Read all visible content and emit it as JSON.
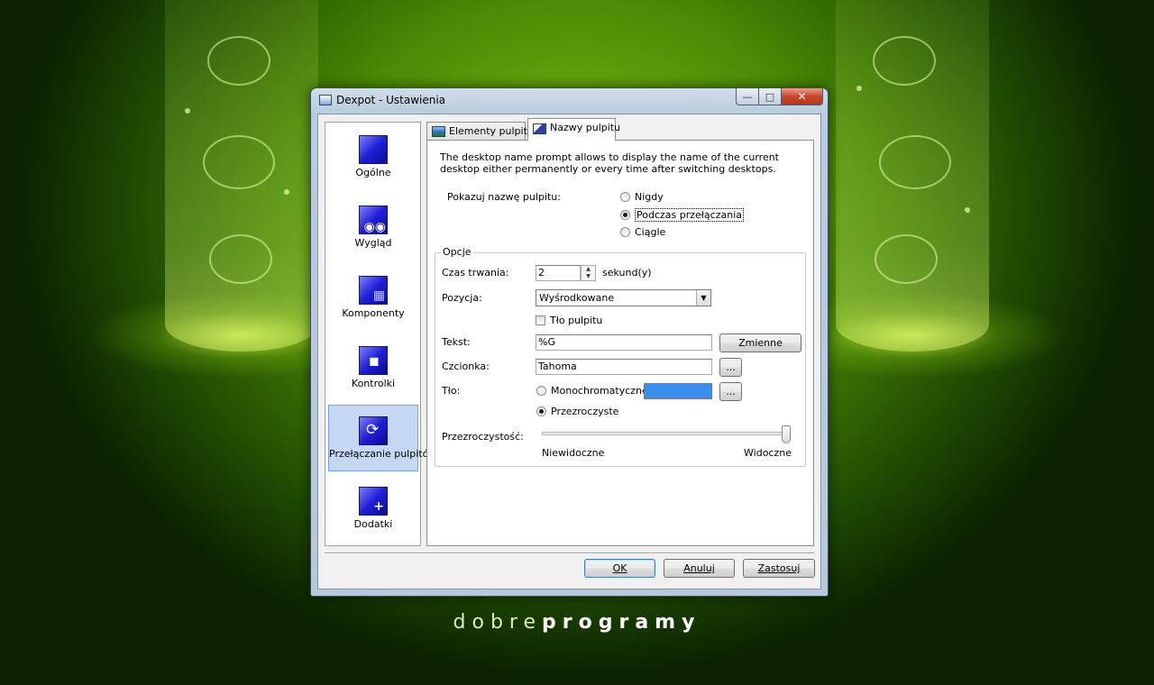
{
  "background": {
    "brand_regular": "dobre",
    "brand_bold": "programy",
    "accent_color": "#7fbe12"
  },
  "window": {
    "title": "Dexpot - Ustawienia",
    "icon": "dexpot-app-icon",
    "caption_buttons": {
      "minimize": "minimize-icon",
      "maximize": "maximize-icon",
      "close": "close-icon"
    }
  },
  "nav": {
    "items": [
      {
        "label": "Ogólne",
        "icon": "general-icon",
        "active": false
      },
      {
        "label": "Wygląd",
        "icon": "appearance-icon",
        "active": false
      },
      {
        "label": "Komponenty",
        "icon": "components-icon",
        "active": false
      },
      {
        "label": "Kontrolki",
        "icon": "controls-icon",
        "active": false
      },
      {
        "label": "Przełączanie pulpitów",
        "icon": "desktop-switching-icon",
        "active": true
      },
      {
        "label": "Dodatki",
        "icon": "addons-icon",
        "active": false
      }
    ],
    "active_color": "#c5d8f3"
  },
  "tabs": [
    {
      "label": "Elementy pulpitu",
      "icon": "desktop-elements-icon",
      "active": false
    },
    {
      "label": "Nazwy pulpitu",
      "icon": "desktop-names-icon",
      "active": true
    }
  ],
  "panel": {
    "description": "The desktop name prompt allows to display the name of the current desktop either permanently or every time after switching desktops.",
    "show_name_label": "Pokazuj nazwę pulpitu:",
    "show_options": [
      {
        "label": "Nigdy",
        "selected": false
      },
      {
        "label": "Podczas przełączania",
        "selected": true
      },
      {
        "label": "Ciągle",
        "selected": false
      }
    ],
    "options_group": {
      "title": "Opcje",
      "duration_label": "Czas trwania:",
      "duration_value": "2",
      "duration_unit": "sekund(y)",
      "position_label": "Pozycja:",
      "position_value": "Wyśrodkowane",
      "desktop_bg_checkbox": {
        "label": "Tło pulpitu",
        "checked": false
      },
      "text_label": "Tekst:",
      "text_value": "%G",
      "variables_button": "Zmienne",
      "font_label": "Czcionka:",
      "font_value": "Tahoma",
      "browse_button": "...",
      "background_label": "Tło:",
      "background_options": [
        {
          "label": "Monochromatyczne",
          "selected": false
        },
        {
          "label": "Przezroczyste",
          "selected": true
        }
      ],
      "mono_color": "#3b8ef0",
      "transparency_label": "Przezroczystość:",
      "transparency_min_label": "Niewidoczne",
      "transparency_max_label": "Widoczne",
      "transparency_value": 1.0
    }
  },
  "footer": {
    "ok": "OK",
    "cancel": "Anuluj",
    "apply": "Zastosuj"
  }
}
